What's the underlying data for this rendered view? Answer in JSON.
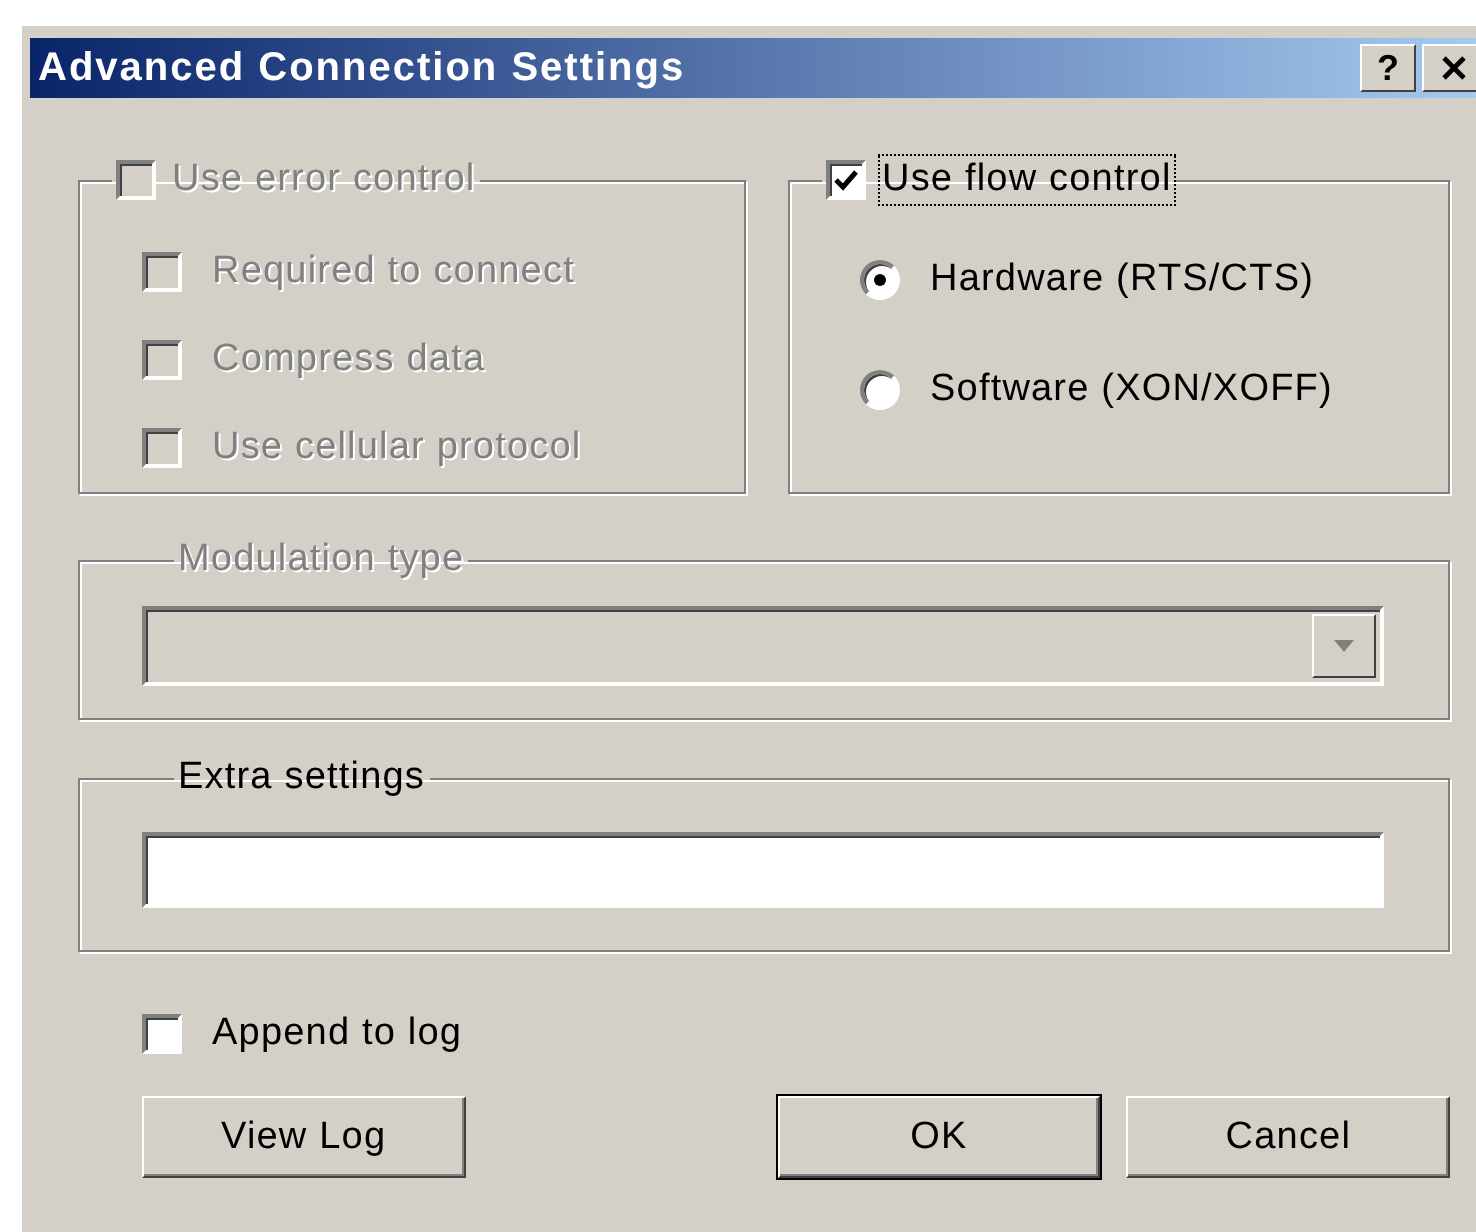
{
  "window": {
    "title": "Advanced Connection Settings",
    "help_button": "?"
  },
  "error_control": {
    "label": "Use error control",
    "checked": false,
    "disabled": true,
    "options": [
      {
        "label": "Required to connect",
        "checked": false,
        "disabled": true
      },
      {
        "label": "Compress data",
        "checked": false,
        "disabled": true
      },
      {
        "label": "Use cellular protocol",
        "checked": false,
        "disabled": true
      }
    ]
  },
  "flow_control": {
    "label": "Use flow control",
    "checked": true,
    "focused": true,
    "options": [
      {
        "label": "Hardware (RTS/CTS)",
        "selected": true
      },
      {
        "label": "Software (XON/XOFF)",
        "selected": false
      }
    ]
  },
  "modulation": {
    "label": "Modulation type",
    "disabled": true
  },
  "extra_settings": {
    "label": "Extra settings"
  },
  "append_to_log": {
    "label": "Append to log",
    "checked": false
  },
  "buttons": [
    {
      "label": "View Log",
      "default": false
    },
    {
      "label": "OK",
      "default": true
    },
    {
      "label": "Cancel",
      "default": false
    }
  ]
}
